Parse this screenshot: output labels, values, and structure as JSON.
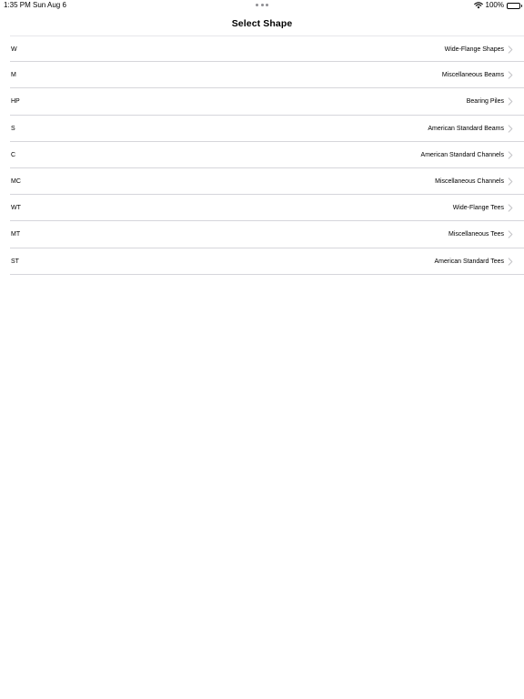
{
  "status_bar": {
    "time": "1:35 PM",
    "date": "Sun Aug 6",
    "battery": "100%"
  },
  "nav": {
    "title": "Select Shape"
  },
  "shapes": [
    {
      "code": "W",
      "description": "Wide-Flange Shapes"
    },
    {
      "code": "M",
      "description": "Miscellaneous Beams"
    },
    {
      "code": "HP",
      "description": "Bearing Piles"
    },
    {
      "code": "S",
      "description": "American Standard Beams"
    },
    {
      "code": "C",
      "description": "American Standard Channels"
    },
    {
      "code": "MC",
      "description": "Miscellaneous Channels"
    },
    {
      "code": "WT",
      "description": "Wide-Flange Tees"
    },
    {
      "code": "MT",
      "description": "Miscellaneous Tees"
    },
    {
      "code": "ST",
      "description": "American Standard Tees"
    }
  ],
  "icons": {
    "row_disclosure": "chevron-right-icon",
    "wifi": "wifi-icon",
    "battery": "battery-icon"
  },
  "colors": {
    "separator": "#d6d6db",
    "chevron": "#c4c4c7"
  }
}
